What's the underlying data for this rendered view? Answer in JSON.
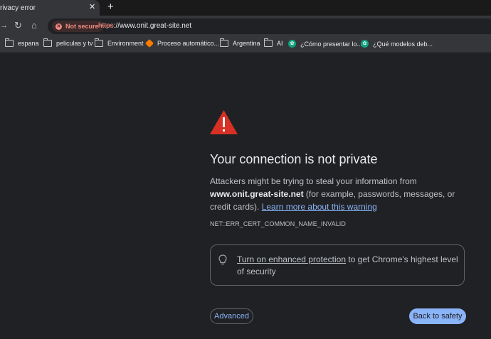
{
  "tab": {
    "title": "rivacy error",
    "close_glyph": "✕",
    "new_tab_glyph": "+"
  },
  "toolbar": {
    "forward_glyph": "→",
    "reload_glyph": "↻",
    "home_glyph": "⌂",
    "security_chip": "Not secure",
    "url_scheme": "https",
    "url_rest": "://www.onit.great-site.net"
  },
  "bookmarks": [
    {
      "icon": "folder-icon",
      "label": "espana"
    },
    {
      "icon": "folder-icon",
      "label": "peliculas y tv"
    },
    {
      "icon": "folder-icon",
      "label": "Environment"
    },
    {
      "icon": "flow-app-icon",
      "label": "Proceso automático..."
    },
    {
      "icon": "folder-icon",
      "label": "Argentina"
    },
    {
      "icon": "folder-icon",
      "label": "AI"
    },
    {
      "icon": "chatgpt-icon",
      "label": "¿Cómo presentar lo..."
    },
    {
      "icon": "chatgpt-icon",
      "label": "¿Qué modelos deb..."
    }
  ],
  "interstitial": {
    "heading": "Your connection is not private",
    "body_prefix": "Attackers might be trying to steal your information from",
    "host": "www.onit.great-site.net",
    "body_suffix": "(for example, passwords, messages, or credit cards).",
    "learn_more": "Learn more about this warning",
    "error_code": "NET::ERR_CERT_COMMON_NAME_INVALID",
    "protection_link": "Turn on enhanced protection",
    "protection_text": "to get Chrome's highest level of security",
    "advanced_button": "Advanced",
    "back_button": "Back to safety"
  },
  "colors": {
    "warning_red": "#d93025",
    "accent_blue": "#8ab4f8",
    "background": "#202124"
  }
}
